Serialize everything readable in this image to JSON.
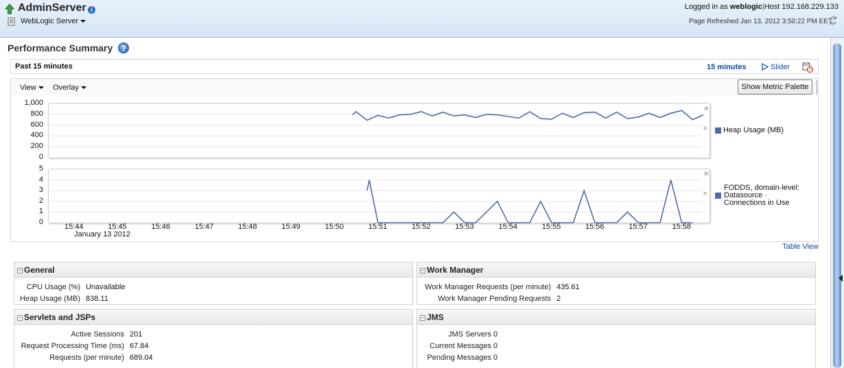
{
  "header": {
    "server_name": "AdminServer",
    "server_menu": "WebLogic Server",
    "logged_in_prefix": "Logged in as",
    "user": "weblogic",
    "host_label": "Host",
    "host": "192.168.229.133",
    "refresh": "Page Refreshed Jan 13, 2012 3:50:22 PM EET"
  },
  "page": {
    "title": "Performance Summary"
  },
  "timebar": {
    "range_label": "Past 15 minutes",
    "duration": "15 minutes",
    "slider": "Slider"
  },
  "toolbar": {
    "view": "View",
    "overlay": "Overlay",
    "show_palette": "Show Metric Palette"
  },
  "chart_data": [
    {
      "type": "line",
      "series": [
        {
          "name": "Heap Usage (MB)",
          "color": "#4f69aa",
          "x": [
            "15:50:25",
            "15:50:30",
            "15:50:45",
            "15:51:00",
            "15:51:15",
            "15:51:30",
            "15:51:45",
            "15:52:00",
            "15:52:15",
            "15:52:30",
            "15:52:45",
            "15:53:00",
            "15:53:15",
            "15:53:30",
            "15:53:45",
            "15:54:00",
            "15:54:15",
            "15:54:30",
            "15:54:45",
            "15:55:00",
            "15:55:15",
            "15:55:30",
            "15:55:45",
            "15:56:00",
            "15:56:15",
            "15:56:30",
            "15:56:45",
            "15:57:00",
            "15:57:15",
            "15:57:30",
            "15:57:45",
            "15:58:00",
            "15:58:15",
            "15:58:30"
          ],
          "values": [
            790,
            850,
            690,
            780,
            730,
            790,
            800,
            850,
            770,
            840,
            770,
            790,
            740,
            800,
            790,
            760,
            730,
            850,
            720,
            710,
            820,
            740,
            830,
            840,
            730,
            840,
            720,
            750,
            820,
            740,
            820,
            870,
            700,
            790
          ]
        }
      ],
      "ylim": [
        0,
        1000
      ],
      "yticks": [
        "1,000",
        "800",
        "600",
        "400",
        "200",
        "0"
      ]
    },
    {
      "type": "line",
      "series": [
        {
          "name": "FODDS, domain-level: Datasource · Connections in Use",
          "color": "#4f69aa",
          "x": [
            "15:50:45",
            "15:50:48",
            "15:51:00",
            "15:51:30",
            "15:51:45",
            "15:52:00",
            "15:52:15",
            "15:52:30",
            "15:52:45",
            "15:53:00",
            "15:53:15",
            "15:53:30",
            "15:53:45",
            "15:54:00",
            "15:54:15",
            "15:54:30",
            "15:54:45",
            "15:55:00",
            "15:55:15",
            "15:55:30",
            "15:55:45",
            "15:56:00",
            "15:56:15",
            "15:56:30",
            "15:56:45",
            "15:57:00",
            "15:57:15",
            "15:57:30",
            "15:57:45",
            "15:58:00",
            "15:58:15"
          ],
          "values": [
            3,
            4,
            0,
            0,
            0,
            0,
            0,
            0,
            1,
            0,
            0,
            1,
            2,
            0,
            0,
            0,
            2,
            0,
            0,
            0,
            3,
            0,
            0,
            0,
            1,
            0,
            0,
            0,
            4,
            0,
            0
          ]
        }
      ],
      "ylim": [
        0,
        5
      ],
      "yticks": [
        "5",
        "4",
        "3",
        "2",
        "1",
        "0"
      ],
      "xticks": [
        "15:44",
        "15:45",
        "15:46",
        "15:47",
        "15:48",
        "15:49",
        "15:50",
        "15:51",
        "15:52",
        "15:53",
        "15:54",
        "15:55",
        "15:56",
        "15:57",
        "15:58"
      ],
      "xdate": "January 13 2012"
    }
  ],
  "legend": {
    "heap": "Heap Usage (MB)",
    "fodds_1": "FODDS, domain-level:",
    "fodds_2": "Datasource ·",
    "fodds_3": "Connections in Use"
  },
  "table_view": "Table View",
  "panels": {
    "general": {
      "title": "General",
      "rows": [
        {
          "label": "CPU Usage (%)",
          "value": "Unavailable"
        },
        {
          "label": "Heap Usage (MB)",
          "value": "838.11"
        }
      ]
    },
    "work_manager": {
      "title": "Work Manager",
      "rows": [
        {
          "label": "Work Manager Requests (per minute)",
          "value": "435.61"
        },
        {
          "label": "Work Manager Pending Requests",
          "value": "2"
        }
      ]
    },
    "servlets": {
      "title": "Servlets and JSPs",
      "rows": [
        {
          "label": "Active Sessions",
          "value": "201"
        },
        {
          "label": "Request Processing Time (ms)",
          "value": "67.84"
        },
        {
          "label": "Requests (per minute)",
          "value": "689.04"
        }
      ]
    },
    "jms": {
      "title": "JMS",
      "rows": [
        {
          "label": "JMS Servers",
          "value": "0"
        },
        {
          "label": "Current Messages",
          "value": "0"
        },
        {
          "label": "Pending Messages",
          "value": "0"
        }
      ]
    }
  },
  "icons": {
    "up": "arrow-up-icon",
    "info": "info-icon",
    "server": "server-icon",
    "refresh": "refresh-icon",
    "help": "help-icon",
    "slider": "play-triangle-icon",
    "calendar": "calendar-clock-icon"
  }
}
